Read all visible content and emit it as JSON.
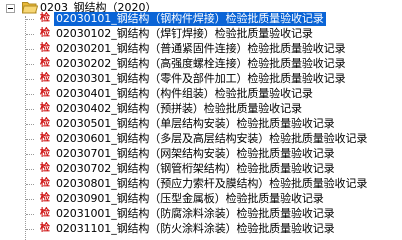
{
  "tree": {
    "root": {
      "label": "0203_钢结构（2020）",
      "expanded": true,
      "icon": "folder-open-icon"
    },
    "item_icon_text": "检",
    "items": [
      {
        "label": "02030101_钢结构（钢构件焊接）检验批质量验收记录",
        "selected": true
      },
      {
        "label": "02030102_钢结构（焊钉焊接）检验批质量验收记录",
        "selected": false
      },
      {
        "label": "02030201_钢结构（普通紧固件连接）检验批质量验收记录",
        "selected": false
      },
      {
        "label": "02030202_钢结构（高强度螺栓连接）检验批质量验收记录",
        "selected": false
      },
      {
        "label": "02030301_钢结构（零件及部件加工）检验批质量验收记录",
        "selected": false
      },
      {
        "label": "02030401_钢结构（构件组装）检验批质量验收记录",
        "selected": false
      },
      {
        "label": "02030402_钢结构（预拼装）检验批质量验收记录",
        "selected": false
      },
      {
        "label": "02030501_钢结构（单层结构安装）检验批质量验收记录",
        "selected": false
      },
      {
        "label": "02030601_钢结构（多层及高层结构安装）检验批质量验收记录",
        "selected": false
      },
      {
        "label": "02030701_钢结构（网架结构安装）检验批质量验收记录",
        "selected": false
      },
      {
        "label": "02030702_钢结构（钢管桁架结构）检验批质量验收记录",
        "selected": false
      },
      {
        "label": "02030801_钢结构（预应力索杆及膜结构）检验批质量验收记录",
        "selected": false
      },
      {
        "label": "02030901_钢结构（压型金属板）检验批质量验收记录",
        "selected": false
      },
      {
        "label": "02031001_钢结构（防腐涂料涂装）检验批质量验收记录",
        "selected": false
      },
      {
        "label": "02031101_钢结构（防火涂料涂装）检验批质量验收记录",
        "selected": false
      }
    ]
  },
  "colors": {
    "selection_bg": "#0a64d6",
    "selection_text": "#ffffff",
    "check_icon": "#d01818",
    "folder": "#f2c94c",
    "tree_line": "#9a9a9a"
  }
}
